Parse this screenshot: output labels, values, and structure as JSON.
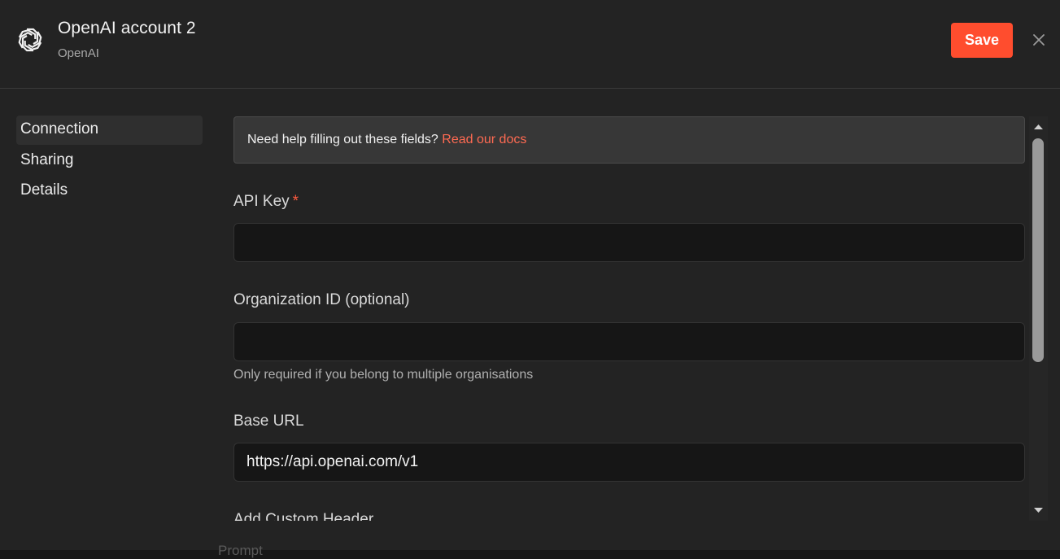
{
  "header": {
    "title": "OpenAI account 2",
    "subtitle": "OpenAI",
    "save_label": "Save"
  },
  "sidebar": {
    "items": [
      {
        "label": "Connection",
        "active": true
      },
      {
        "label": "Sharing",
        "active": false
      },
      {
        "label": "Details",
        "active": false
      }
    ]
  },
  "help": {
    "text": "Need help filling out these fields?",
    "link": "Read our docs"
  },
  "fields": {
    "api_key": {
      "label": "API Key",
      "required_mark": "*",
      "value": ""
    },
    "org_id": {
      "label": "Organization ID (optional)",
      "value": "",
      "hint": "Only required if you belong to multiple organisations"
    },
    "base_url": {
      "label": "Base URL",
      "value": "https://api.openai.com/v1"
    },
    "custom_header": {
      "label": "Add Custom Header"
    }
  },
  "background": {
    "partial_label": "Prompt"
  },
  "colors": {
    "accent": "#ff4d2e",
    "link": "#ff6a52",
    "background": "#232323"
  }
}
